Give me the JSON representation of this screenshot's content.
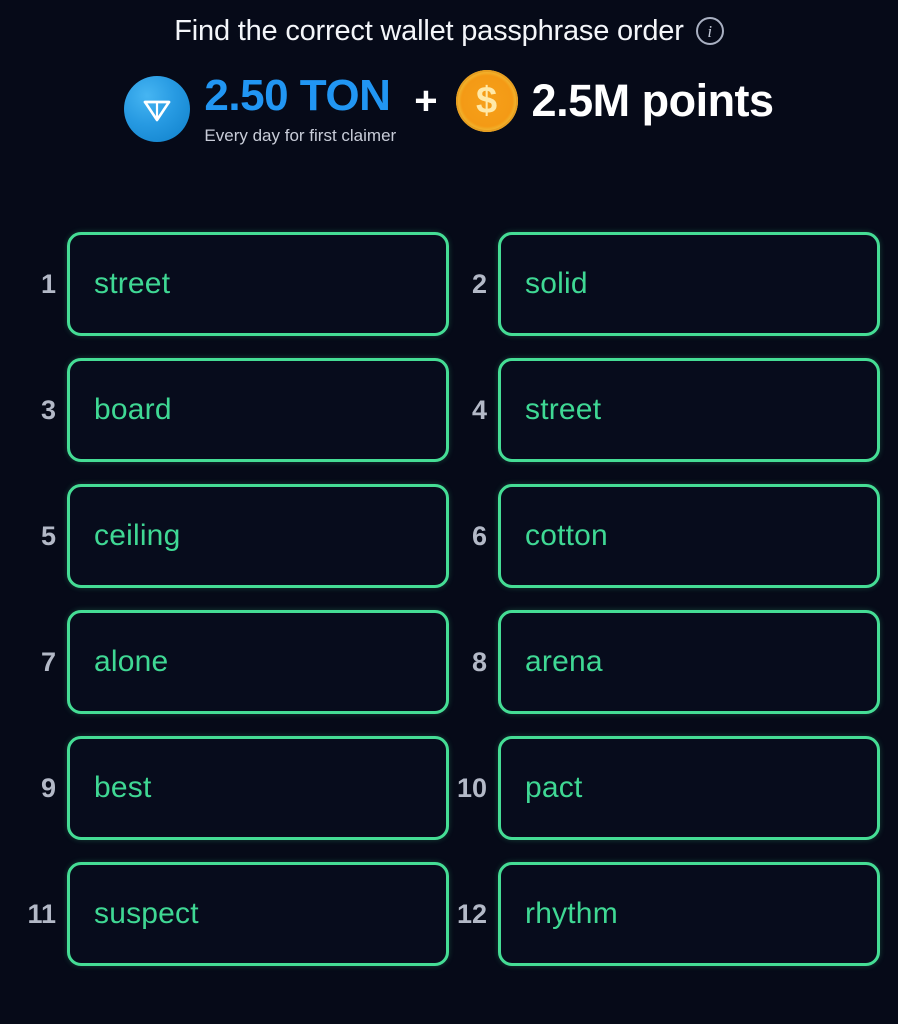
{
  "header": {
    "title": "Find the correct wallet passphrase order",
    "info_icon": "info-circle-icon"
  },
  "reward": {
    "ton_icon": "ton-coin-icon",
    "ton_amount": "2.50 TON",
    "ton_subtitle": "Every day for first claimer",
    "plus": "+",
    "coin_icon": "dollar-coin-icon",
    "coin_symbol": "$",
    "points_amount": "2.5M points"
  },
  "colors": {
    "background": "#060a18",
    "accent_green": "#3fd894",
    "ton_blue": "#2196f3",
    "coin_orange": "#f49a15",
    "index_gray": "#b3b9c7",
    "title_white": "#f4f6fa"
  },
  "words": [
    {
      "index": "1",
      "word": "street"
    },
    {
      "index": "2",
      "word": "solid"
    },
    {
      "index": "3",
      "word": "board"
    },
    {
      "index": "4",
      "word": "street"
    },
    {
      "index": "5",
      "word": "ceiling"
    },
    {
      "index": "6",
      "word": "cotton"
    },
    {
      "index": "7",
      "word": "alone"
    },
    {
      "index": "8",
      "word": "arena"
    },
    {
      "index": "9",
      "word": "best"
    },
    {
      "index": "10",
      "word": "pact"
    },
    {
      "index": "11",
      "word": "suspect"
    },
    {
      "index": "12",
      "word": "rhythm"
    }
  ]
}
